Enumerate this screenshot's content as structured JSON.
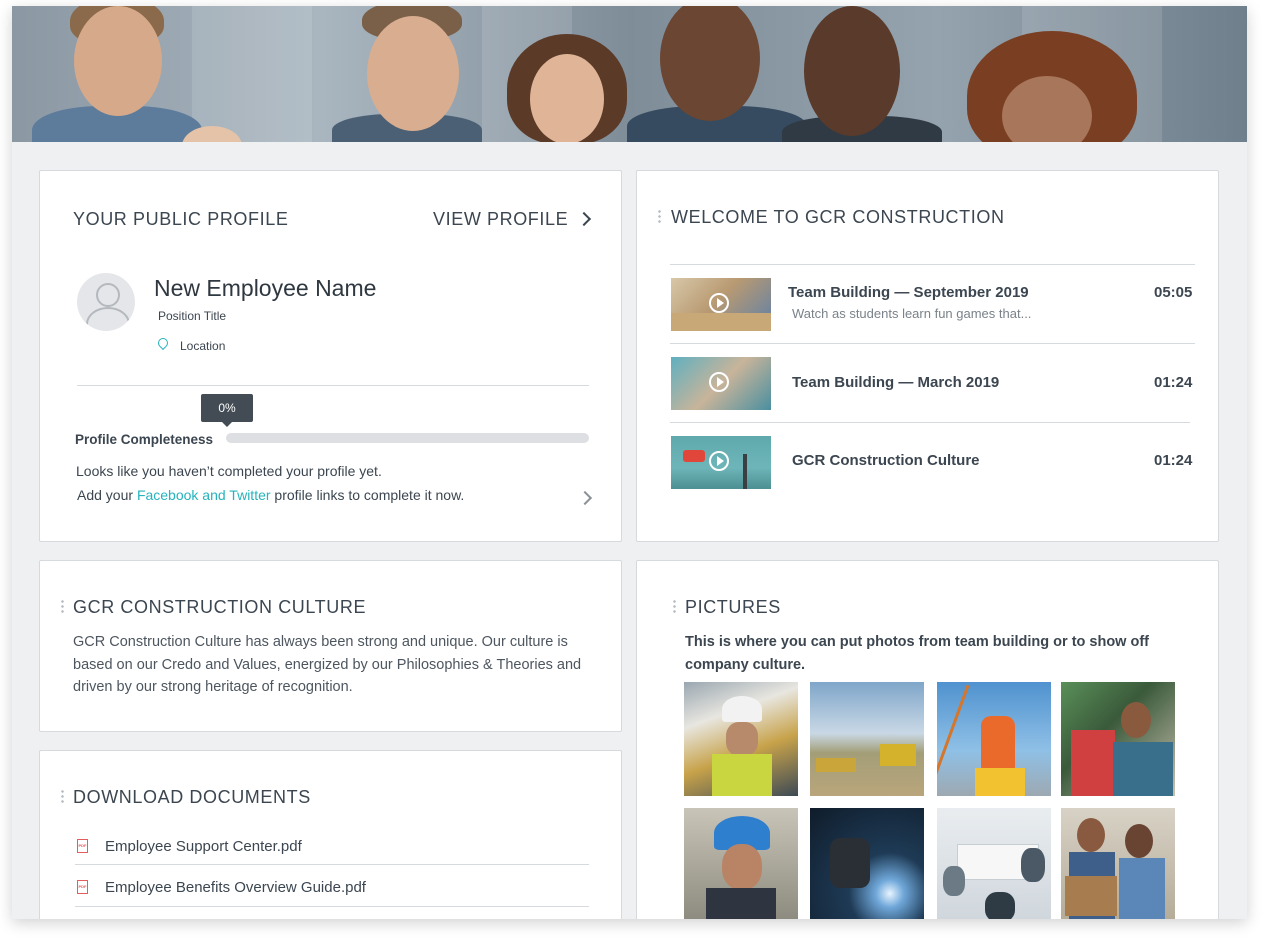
{
  "profile": {
    "title": "YOUR PUBLIC PROFILE",
    "view_link": "VIEW PROFILE",
    "name": "New Employee Name",
    "position": "Position Title",
    "location": "Location",
    "completeness_label": "Profile Completeness",
    "completeness_value": "0%",
    "completeness_fraction": 0,
    "message_line1": "Looks like you haven’t completed your profile yet.",
    "message_prefix": "Add your ",
    "message_link": "Facebook and Twitter",
    "message_suffix": " profile links to complete it now.",
    "accent_color": "#25b3bd"
  },
  "welcome": {
    "title": "WELCOME TO GCR CONSTRUCTION",
    "videos": [
      {
        "title": "Team Building — September 2019",
        "subtitle": "Watch as students learn fun games that...",
        "duration": "05:05"
      },
      {
        "title": "Team Building — March 2019",
        "subtitle": "",
        "duration": "01:24"
      },
      {
        "title": "GCR Construction Culture",
        "subtitle": "",
        "duration": "01:24"
      }
    ]
  },
  "culture": {
    "title": "GCR CONSTRUCTION CULTURE",
    "body": "GCR Construction Culture has always been strong and unique. Our culture is based on our Credo and Values, energized by our Philosophies & Theories and driven by our strong heritage of recognition."
  },
  "pictures": {
    "title": "PICTURES",
    "description": "This is where you can put photos from team building or to show off company culture."
  },
  "documents": {
    "title": "DOWNLOAD DOCUMENTS",
    "icon_label": "PDF",
    "files": [
      {
        "name": "Employee Support Center.pdf"
      },
      {
        "name": "Employee Benefits Overview Guide.pdf"
      }
    ]
  }
}
